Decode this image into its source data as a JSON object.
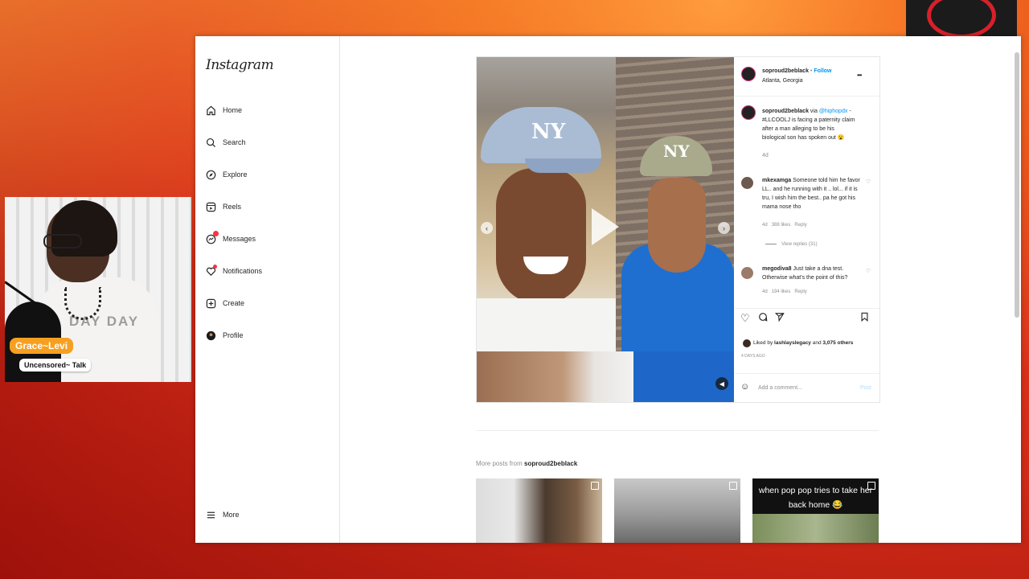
{
  "instagram": {
    "logo": "Instagram",
    "nav": [
      {
        "label": "Home",
        "icon": "home-icon"
      },
      {
        "label": "Search",
        "icon": "search-icon"
      },
      {
        "label": "Explore",
        "icon": "compass-icon"
      },
      {
        "label": "Reels",
        "icon": "reels-icon"
      },
      {
        "label": "Messages",
        "icon": "messenger-icon"
      },
      {
        "label": "Notifications",
        "icon": "heart-icon"
      },
      {
        "label": "Create",
        "icon": "plus-square-icon"
      },
      {
        "label": "Profile",
        "icon": "profile-avatar-icon"
      }
    ],
    "more": "More"
  },
  "post": {
    "username": "soproud2beblack",
    "dot": "•",
    "follow": "Follow",
    "location": "Atlanta, Georgia",
    "options": "•••",
    "caption": {
      "username": "soproud2beblack",
      "text_pre": "via",
      "mention": "@hiphopdx",
      "text": "- #LLCOOLJ is facing a paternity claim after a man alleging to be his biological son has spoken out 😮",
      "time": "4d"
    },
    "comments": [
      {
        "username": "mkexamga",
        "text": "Someone told him he favor LL.. and he running with it .. lol... if it is tru, I wish him the best.. pa he got his mama nose tho",
        "time": "4d",
        "likes": "388 likes",
        "reply": "Reply",
        "view_replies": "View replies (31)"
      },
      {
        "username": "megodiva8",
        "text": "Just take a dna test. Otherwise what's the point of this?",
        "time": "4d",
        "likes": "194 likes",
        "reply": "Reply"
      }
    ],
    "liked_by_pre": "Liked by",
    "liked_by_user": "lashlayslegacy",
    "liked_by_post": "and",
    "liked_by_others": "3,075 others",
    "posted": "4 DAYS AGO",
    "add_comment_placeholder": "Add a comment...",
    "post_button": "Post",
    "cap_logo": "NY"
  },
  "more_posts": {
    "label_pre": "More posts from",
    "label_user": "soproud2beblack",
    "thumb3_text": "when pop pop tries to take her back home 😂"
  },
  "webcam": {
    "name": "Grace~Levi",
    "show": "Uncensored~ Talk",
    "shirt": "DAY DAY"
  },
  "colors": {
    "accent_blue": "#0095f6",
    "name_tag": "#f6a021",
    "notification_badge": "#ff3040"
  }
}
